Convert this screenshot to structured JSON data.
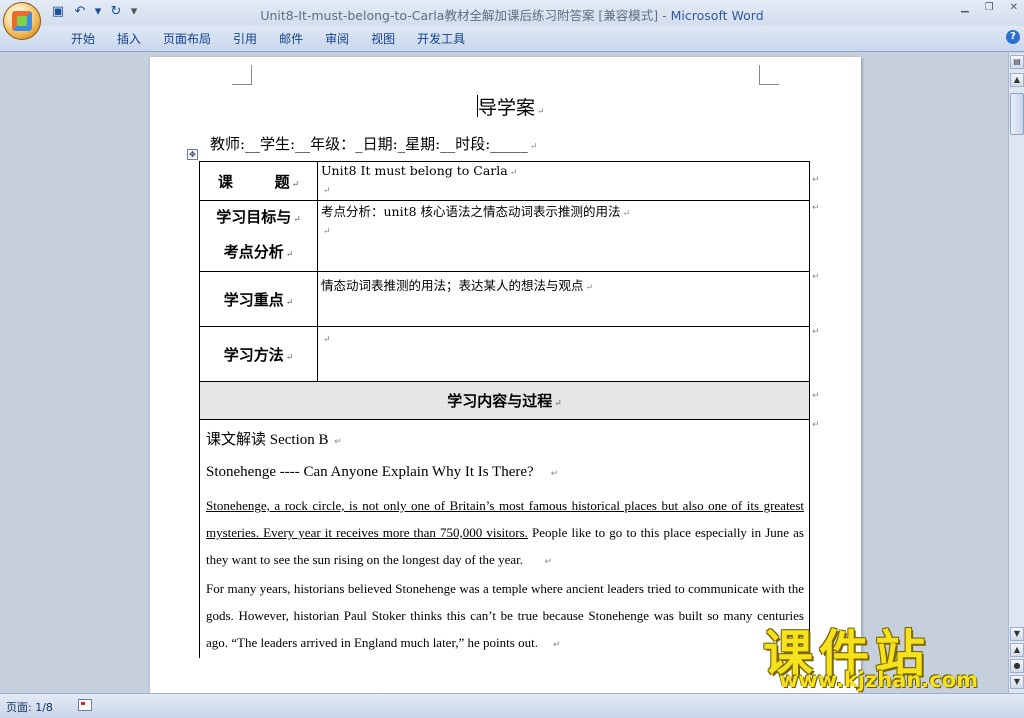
{
  "window": {
    "title": "Unit8-It-must-belong-to-Carla教材全解加课后练习附答案 [兼容模式]",
    "separator": " - ",
    "app_name": "Microsoft Word",
    "controls": {
      "minimize": "▁",
      "restore": "❐",
      "close": "✕"
    }
  },
  "quick_access": {
    "save": "▣",
    "undo": "↶",
    "undo_drop": "▾",
    "redo": "↻",
    "more": "▾"
  },
  "ribbon": {
    "tabs": [
      {
        "label": "开始"
      },
      {
        "label": "插入"
      },
      {
        "label": "页面布局"
      },
      {
        "label": "引用"
      },
      {
        "label": "邮件"
      },
      {
        "label": "审阅"
      },
      {
        "label": "视图"
      },
      {
        "label": "开发工具"
      }
    ],
    "help": "?"
  },
  "document": {
    "title": "导学案",
    "teacher_line": "教师:__学生:__年级：_日期:_星期:__时段:_____",
    "para_mark": "↵",
    "table": {
      "row1_label": "课        题",
      "row1_value": "Unit8 It must belong to Carla",
      "row2_label_a": "学习目标与",
      "row2_label_b": "考点分析",
      "row2_value": "考点分析：unit8 核心语法之情态动词表示推测的用法",
      "row3_label": "学习重点",
      "row3_value": "情态动词表推测的用法；表达某人的想法与观点",
      "row4_label": "学习方法",
      "row4_value": "",
      "header": "学习内容与过程"
    },
    "content": {
      "section": "课文解读 Section B",
      "heading": "Stonehenge ---- Can Anyone Explain Why It Is There?",
      "p1_underlined": "Stonehenge, a rock circle, is not only one of Britain’s most famous historical places but also one of its greatest mysteries. Every year it receives more than 750,000 visitors.",
      "p1_rest": " People like to go to this place especially in June as they want to see the sun rising on the longest day of the year.",
      "p2": "For many years, historians believed Stonehenge was a temple where ancient leaders tried to communicate with the gods. However, historian Paul Stoker thinks this can’t be true because Stonehenge was built so many centuries ago. “The leaders arrived in England much later,” he points out."
    }
  },
  "status": {
    "page": "页面: 1/8"
  },
  "watermark": {
    "big": "课件站",
    "small": "www.kjzhan.com"
  }
}
